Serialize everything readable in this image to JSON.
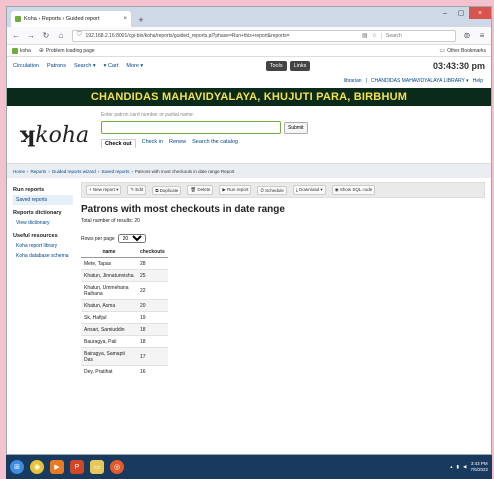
{
  "browser": {
    "tab_title": "Koha › Reports › Guided report",
    "url": "192.168.2.16:8001/cgi-bin/koha/reports/guided_reports.pl?phase=Run+this+report&reports=",
    "search_placeholder": "Search",
    "bookmarks": [
      {
        "label": "koha"
      },
      {
        "label": "Problem loading page"
      }
    ],
    "other_bookmarks": "Other Bookmarks"
  },
  "koha_nav": {
    "items": [
      "Circulation",
      "Patrons",
      "Search ▾",
      "▾ Cart",
      "More ▾"
    ],
    "tools": "Tools",
    "links": "Links",
    "clock": "03:43:30 pm"
  },
  "userbar": {
    "user": "librarian",
    "library": "CHANDIDAS MAHAVIDYALAYA LIBRARY ▾",
    "help": "Help"
  },
  "banner": "CHANDIDAS MAHAVIDYALAYA, KHUJUTI PARA, BIRBHUM",
  "header": {
    "logo": "koha",
    "hint": "Enter patron card number or partial name:",
    "submit": "Submit",
    "tabs": [
      "Check out",
      "Check in",
      "Renew",
      "Search the catalog"
    ]
  },
  "breadcrumb": [
    "Home",
    "Reports",
    "Guided reports wizard",
    "Saved reports",
    "Patrons with most checkouts in date range Report"
  ],
  "sidebar": {
    "sections": [
      {
        "heading": "Run reports",
        "links": [
          "Saved reports"
        ]
      },
      {
        "heading": "Reports dictionary",
        "links": [
          "View dictionary"
        ]
      },
      {
        "heading": "Useful resources",
        "links": [
          "Koha report library",
          "Koha database schema"
        ]
      }
    ]
  },
  "toolbar": [
    "+ New report ▾",
    "✎ Edit",
    "⧉ Duplicate",
    "🗑 Delete",
    "▶ Run report",
    "⏱ Schedule",
    "⤓ Download ▾",
    "◉ Show SQL code"
  ],
  "report": {
    "title": "Patrons with most checkouts in date range",
    "total": "Total number of results: 20",
    "rows_per_page_label": "Rows per page",
    "rows_per_page": "20",
    "columns": [
      "name",
      "checkouts"
    ],
    "rows": [
      [
        "Mete, Tapas",
        "28"
      ],
      [
        "Khatun, Jinnatunnisha",
        "25"
      ],
      [
        "Khatun, Ummehana Raihana",
        "22"
      ],
      [
        "Khatun, Asma",
        "20"
      ],
      [
        "Sk, Hafijul",
        "19"
      ],
      [
        "Ansari, Samiuddin",
        "18"
      ],
      [
        "Bauragya, Pali",
        "18"
      ],
      [
        "Bairagya, Samapti Das",
        "17"
      ],
      [
        "Dey, Pratihat",
        "16"
      ]
    ]
  },
  "taskbar": {
    "time": "3:43 PM",
    "date": "7/6/2022"
  }
}
